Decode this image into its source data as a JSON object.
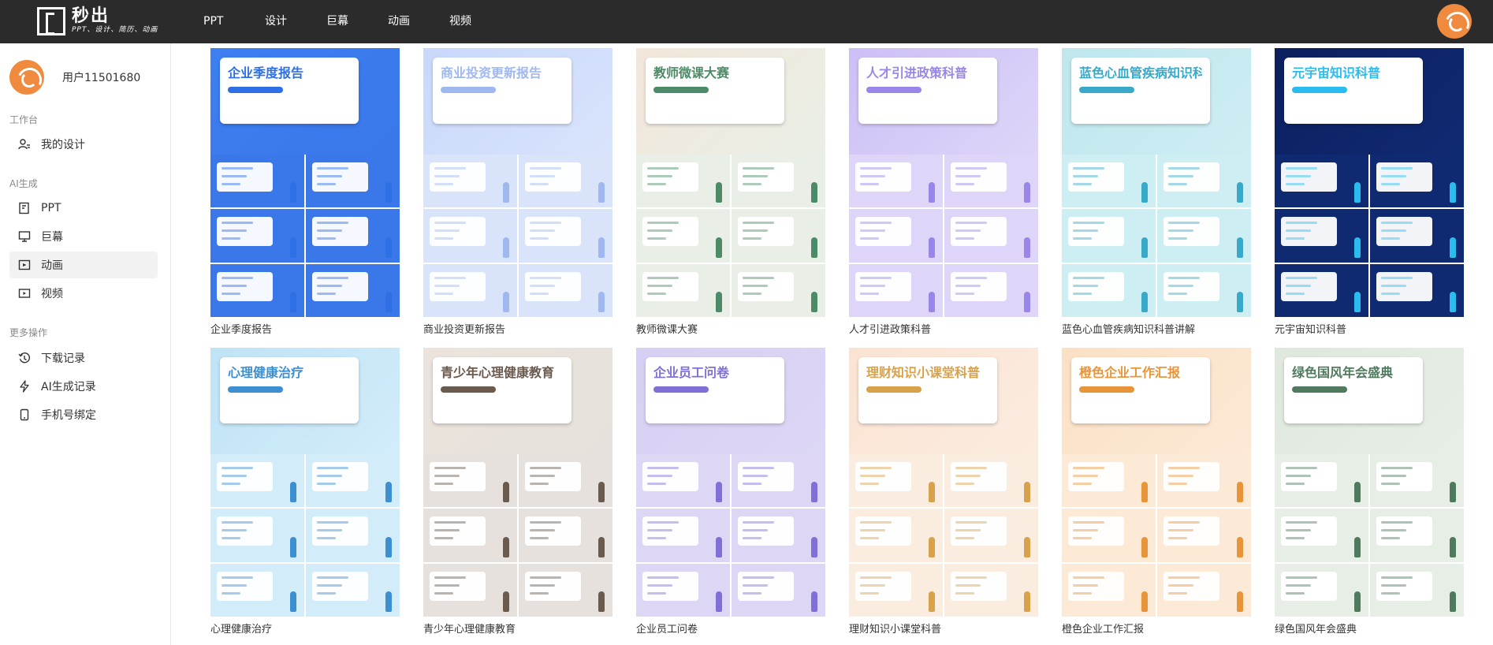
{
  "app": {
    "logo_name": "秒出",
    "logo_tagline": "PPT、设计、简历、动画"
  },
  "nav": {
    "items": [
      {
        "label": "PPT"
      },
      {
        "label": "设计"
      },
      {
        "label": "巨幕"
      },
      {
        "label": "动画"
      },
      {
        "label": "视频"
      }
    ]
  },
  "sidebar": {
    "username": "用户11501680",
    "section_workspace": "工作台",
    "my_design": "我的设计",
    "section_ai": "AI生成",
    "ai_items": [
      {
        "label": "PPT",
        "icon": "ppt-icon"
      },
      {
        "label": "巨幕",
        "icon": "screen-icon"
      },
      {
        "label": "动画",
        "icon": "animation-icon",
        "active": true
      },
      {
        "label": "视频",
        "icon": "video-icon"
      }
    ],
    "section_more": "更多操作",
    "more_items": [
      {
        "label": "下载记录",
        "icon": "download-history-icon"
      },
      {
        "label": "AI生成记录",
        "icon": "lightning-icon"
      },
      {
        "label": "手机号绑定",
        "icon": "phone-icon"
      }
    ]
  },
  "templates": [
    {
      "title": "企业季度报告",
      "hero_title": "企业季度报告",
      "accent": "#2f6fe6",
      "bg": "#3d7ef0",
      "slide_bg": "#3a78ea"
    },
    {
      "title": "商业投资更新报告",
      "hero_title": "商业投资更新报告",
      "accent": "#9fb8f0",
      "bg": "#c9d8fb",
      "slide_bg": "#d9e4fb"
    },
    {
      "title": "教师微课大赛",
      "hero_title": "教师微课大赛",
      "accent": "#4d8a67",
      "bg": "#f3e6da",
      "slide_bg": "#e9efe6"
    },
    {
      "title": "人才引进政策科普",
      "hero_title": "人才引进政策科普",
      "accent": "#9a86e8",
      "bg": "#cdbff6",
      "slide_bg": "#ded5f8"
    },
    {
      "title": "蓝色心血管疾病知识科普讲解",
      "hero_title": "蓝色心血管疾病知识科普讲解",
      "accent": "#39a9c9",
      "bg": "#bfe6ee",
      "slide_bg": "#cdeef3"
    },
    {
      "title": "元宇宙知识科普",
      "hero_title": "元宇宙知识科普",
      "accent": "#2bbcef",
      "bg": "#0c1f5e",
      "slide_bg": "#102a72"
    },
    {
      "title": "心理健康治疗",
      "hero_title": "心理健康治疗",
      "accent": "#3c8fd1",
      "bg": "#bfe3f6",
      "slide_bg": "#d2ecfa"
    },
    {
      "title": "青少年心理健康教育",
      "hero_title": "青少年心理健康教育",
      "accent": "#6b5a4e",
      "bg": "#ece4dc",
      "slide_bg": "#e6e1dc"
    },
    {
      "title": "企业员工问卷",
      "hero_title": "企业员工问卷",
      "accent": "#7f6fd6",
      "bg": "#d8d0f4",
      "slide_bg": "#ddd6f5"
    },
    {
      "title": "理财知识小课堂科普",
      "hero_title": "理财知识小课堂科普",
      "accent": "#d7a24a",
      "bg": "#fbe3d2",
      "slide_bg": "#fbece0"
    },
    {
      "title": "橙色企业工作汇报",
      "hero_title": "橙色企业工作汇报",
      "accent": "#e8953a",
      "bg": "#fbe0c4",
      "slide_bg": "#fce9d6"
    },
    {
      "title": "绿色国风年会盛典",
      "hero_title": "绿色国风年会盛典",
      "accent": "#4f7a5d",
      "bg": "#dfe8df",
      "slide_bg": "#e7eee6"
    }
  ]
}
